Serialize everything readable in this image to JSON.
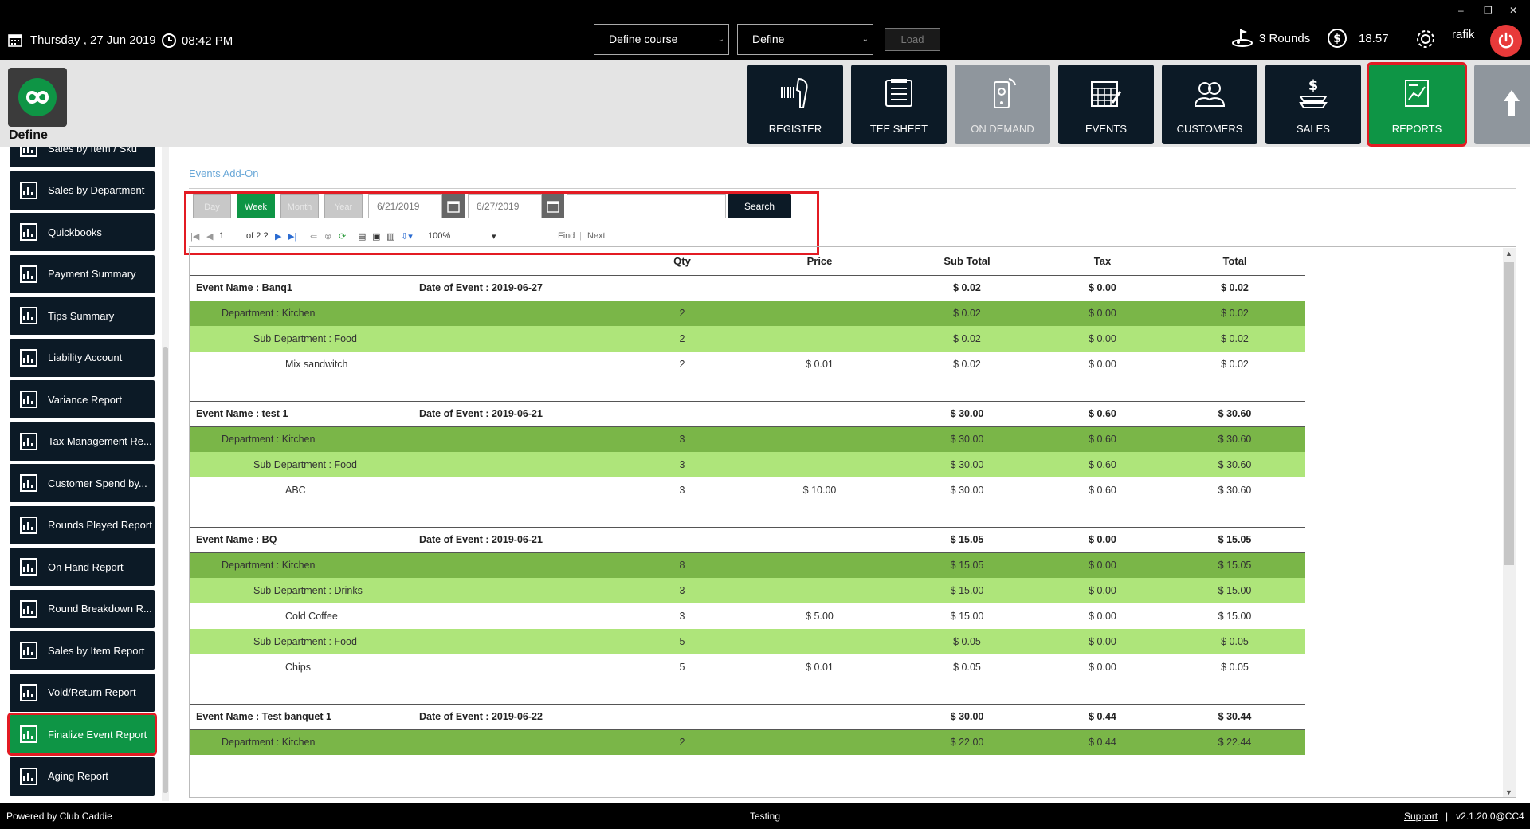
{
  "topbar": {
    "date": "Thursday ,  27 Jun 2019",
    "time": "08:42 PM",
    "course_select": "Define course",
    "define_select": "Define",
    "load_label": "Load",
    "rounds": "3 Rounds",
    "balance": "18.57",
    "user": "rafik",
    "window_controls": [
      "–",
      "❐",
      "✕"
    ]
  },
  "header": {
    "logo_text": "Define",
    "nav": [
      {
        "label": "REGISTER",
        "icon": "barcode-scanner-icon"
      },
      {
        "label": "TEE SHEET",
        "icon": "list-icon"
      },
      {
        "label": "ON DEMAND",
        "icon": "mobile-icon"
      },
      {
        "label": "EVENTS",
        "icon": "calendar-icon"
      },
      {
        "label": "CUSTOMERS",
        "icon": "people-icon"
      },
      {
        "label": "SALES",
        "icon": "dollar-icon"
      },
      {
        "label": "REPORTS",
        "icon": "report-icon"
      }
    ]
  },
  "sidebar": {
    "items": [
      {
        "label": "Sales by Item / Sku",
        "icon": "bar-chart-icon"
      },
      {
        "label": "Sales by Department",
        "icon": "calendar-list-icon"
      },
      {
        "label": "Quickbooks",
        "icon": "quickbooks-icon"
      },
      {
        "label": "Payment Summary",
        "icon": "document-icon"
      },
      {
        "label": "Tips Summary",
        "icon": "tips-icon"
      },
      {
        "label": "Liability Account",
        "icon": "liability-icon"
      },
      {
        "label": "Variance Report",
        "icon": "variance-icon"
      },
      {
        "label": "Tax Management Re...",
        "icon": "tax-icon"
      },
      {
        "label": "Customer Spend by...",
        "icon": "customers-icon"
      },
      {
        "label": "Rounds Played Report",
        "icon": "golf-flag-icon"
      },
      {
        "label": "On Hand Report",
        "icon": "clipboard-icon"
      },
      {
        "label": "Round Breakdown R...",
        "icon": "golfer-icon"
      },
      {
        "label": "Sales by Item Report",
        "icon": "sale-tag-icon"
      },
      {
        "label": "Void/Return Report",
        "icon": "void-return-icon"
      },
      {
        "label": "Finalize Event Report",
        "icon": "chart-icon"
      },
      {
        "label": "Aging Report",
        "icon": "aging-icon"
      }
    ]
  },
  "report": {
    "title": "Events Add-On",
    "periods": [
      "Day",
      "Week",
      "Month",
      "Year"
    ],
    "from_date": "6/21/2019",
    "to_date": "6/27/2019",
    "search_value": "",
    "search_label": "Search",
    "page_current": "1",
    "page_of": "of  2 ?",
    "zoom": "100%",
    "find_label": "Find",
    "next_label": "Next",
    "columns": [
      "Qty",
      "Price",
      "Sub Total",
      "Tax",
      "Total"
    ],
    "events": [
      {
        "name": "Event Name : Banq1",
        "date": "Date of Event : 2019-06-27",
        "sub": "$ 0.02",
        "tax": "$ 0.00",
        "total": "$ 0.02",
        "rows": [
          {
            "type": "dept",
            "label": "Department : Kitchen",
            "qty": "2",
            "price": "",
            "sub": "$ 0.02",
            "tax": "$ 0.00",
            "total": "$ 0.02"
          },
          {
            "type": "sub",
            "label": "Sub Department : Food",
            "qty": "2",
            "price": "",
            "sub": "$ 0.02",
            "tax": "$ 0.00",
            "total": "$ 0.02"
          },
          {
            "type": "item",
            "label": "Mix sandwitch",
            "qty": "2",
            "price": "$ 0.01",
            "sub": "$ 0.02",
            "tax": "$ 0.00",
            "total": "$ 0.02"
          }
        ]
      },
      {
        "name": "Event Name : test 1",
        "date": "Date of Event : 2019-06-21",
        "sub": "$ 30.00",
        "tax": "$ 0.60",
        "total": "$ 30.60",
        "rows": [
          {
            "type": "dept",
            "label": "Department : Kitchen",
            "qty": "3",
            "price": "",
            "sub": "$ 30.00",
            "tax": "$ 0.60",
            "total": "$ 30.60"
          },
          {
            "type": "sub",
            "label": "Sub Department : Food",
            "qty": "3",
            "price": "",
            "sub": "$ 30.00",
            "tax": "$ 0.60",
            "total": "$ 30.60"
          },
          {
            "type": "item",
            "label": "ABC",
            "qty": "3",
            "price": "$ 10.00",
            "sub": "$ 30.00",
            "tax": "$ 0.60",
            "total": "$ 30.60"
          }
        ]
      },
      {
        "name": "Event Name : BQ",
        "date": "Date of Event : 2019-06-21",
        "sub": "$ 15.05",
        "tax": "$ 0.00",
        "total": "$ 15.05",
        "rows": [
          {
            "type": "dept",
            "label": "Department : Kitchen",
            "qty": "8",
            "price": "",
            "sub": "$ 15.05",
            "tax": "$ 0.00",
            "total": "$ 15.05"
          },
          {
            "type": "sub",
            "label": "Sub Department : Drinks",
            "qty": "3",
            "price": "",
            "sub": "$ 15.00",
            "tax": "$ 0.00",
            "total": "$ 15.00"
          },
          {
            "type": "item",
            "label": "Cold Coffee",
            "qty": "3",
            "price": "$ 5.00",
            "sub": "$ 15.00",
            "tax": "$ 0.00",
            "total": "$ 15.00"
          },
          {
            "type": "sub",
            "label": "Sub Department : Food",
            "qty": "5",
            "price": "",
            "sub": "$ 0.05",
            "tax": "$ 0.00",
            "total": "$ 0.05"
          },
          {
            "type": "item",
            "label": "Chips",
            "qty": "5",
            "price": "$ 0.01",
            "sub": "$ 0.05",
            "tax": "$ 0.00",
            "total": "$ 0.05"
          }
        ]
      },
      {
        "name": "Event Name : Test banquet 1",
        "date": "Date of Event : 2019-06-22",
        "sub": "$ 30.00",
        "tax": "$ 0.44",
        "total": "$ 30.44",
        "rows": [
          {
            "type": "dept",
            "label": "Department : Kitchen",
            "qty": "2",
            "price": "",
            "sub": "$ 22.00",
            "tax": "$ 0.44",
            "total": "$ 22.44"
          }
        ]
      }
    ]
  },
  "footer": {
    "left": "Powered by Club Caddie",
    "center": "Testing",
    "support": "Support",
    "version": "v2.1.20.0@CC4"
  },
  "colors": {
    "accent_green": "#0e9545",
    "highlight_red": "#e31b23",
    "dept_row": "#7ab648",
    "subdept_row": "#aee57a",
    "tile_dark": "#0c1a26"
  }
}
